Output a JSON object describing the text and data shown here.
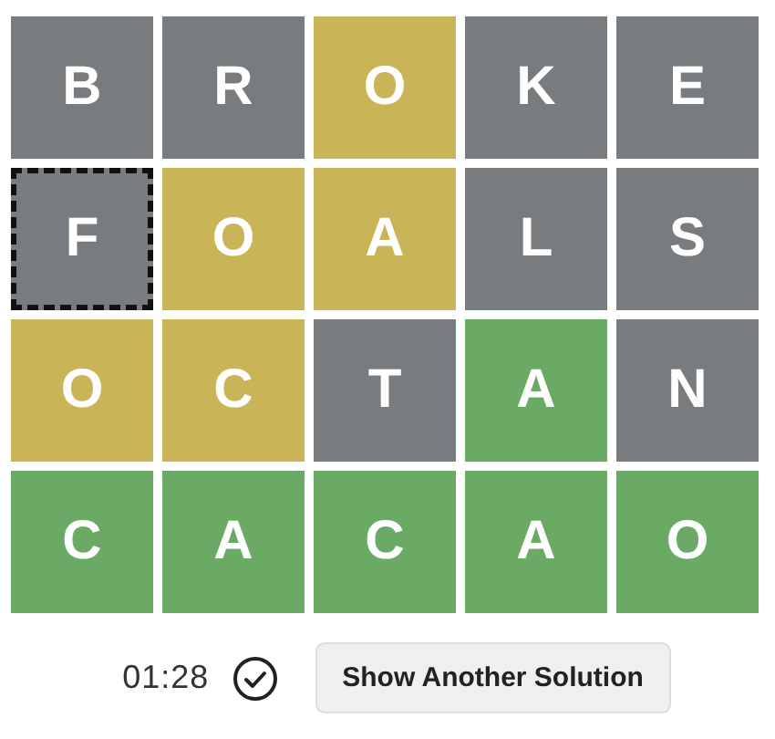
{
  "rows": [
    {
      "tiles": [
        {
          "letter": "B",
          "color": "#787c7e",
          "selected": false
        },
        {
          "letter": "R",
          "color": "#787c7e",
          "selected": false
        },
        {
          "letter": "O",
          "color": "#c9b458",
          "selected": false
        },
        {
          "letter": "K",
          "color": "#787c7e",
          "selected": false
        },
        {
          "letter": "E",
          "color": "#787c7e",
          "selected": false
        }
      ]
    },
    {
      "tiles": [
        {
          "letter": "F",
          "color": "#787c7e",
          "selected": true
        },
        {
          "letter": "O",
          "color": "#c9b458",
          "selected": false
        },
        {
          "letter": "A",
          "color": "#c9b458",
          "selected": false
        },
        {
          "letter": "L",
          "color": "#787c7e",
          "selected": false
        },
        {
          "letter": "S",
          "color": "#787c7e",
          "selected": false
        }
      ]
    },
    {
      "tiles": [
        {
          "letter": "O",
          "color": "#c9b458",
          "selected": false
        },
        {
          "letter": "C",
          "color": "#c9b458",
          "selected": false
        },
        {
          "letter": "T",
          "color": "#787c7e",
          "selected": false
        },
        {
          "letter": "A",
          "color": "#6aaa64",
          "selected": false
        },
        {
          "letter": "N",
          "color": "#787c7e",
          "selected": false
        }
      ]
    },
    {
      "tiles": [
        {
          "letter": "C",
          "color": "#6aaa64",
          "selected": false
        },
        {
          "letter": "A",
          "color": "#6aaa64",
          "selected": false
        },
        {
          "letter": "C",
          "color": "#6aaa64",
          "selected": false
        },
        {
          "letter": "A",
          "color": "#6aaa64",
          "selected": false
        },
        {
          "letter": "O",
          "color": "#6aaa64",
          "selected": false
        }
      ]
    }
  ],
  "footer": {
    "timer": "01:28",
    "solved": true,
    "button": "Show Another Solution"
  }
}
